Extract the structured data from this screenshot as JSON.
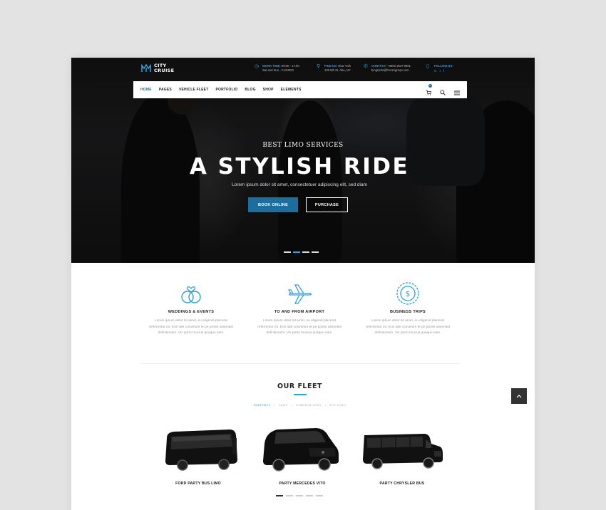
{
  "brand": {
    "line1": "CITY",
    "line2": "CRUISE"
  },
  "topbar": {
    "work_time": {
      "label": "WORK TIME:",
      "line1": "09:00 - 17:00",
      "line2": "Sat and Sun - CLOSED"
    },
    "find_us": {
      "label": "FIND US:",
      "line1": "New York",
      "line2": "128 5th St. Abu, NY"
    },
    "contact": {
      "label": "CONTACT:",
      "line1": "+0800 2537 9901",
      "line2": "bingrizdo@frenzogroup.com"
    },
    "follow": {
      "label": "FOLLOW US:",
      "icons": [
        "in",
        "t",
        "f"
      ]
    }
  },
  "nav": {
    "items": [
      "HOME",
      "PAGES",
      "VEHICLE FLEET",
      "PORTFOLIO",
      "BLOG",
      "SHOP",
      "ELEMENTS"
    ],
    "cart_count": "0"
  },
  "hero": {
    "subtitle": "BEST LIMO SERVICES",
    "title": "A STYLISH RIDE",
    "text": "Lorem ipsum dolor sit amet, consectetuer adipiscing elit, sed diam",
    "book_label": "BOOK ONLINE",
    "purchase_label": "PURCHASE"
  },
  "services": [
    {
      "icon": "rings-icon",
      "title": "WEDDINGS & EVENTS",
      "line1": "Lorem ipsum dolor sit amet, eu eligendi placerat",
      "line2": "referrentur no. Eos tale convenire te pe posse assential",
      "line3": "definitionem. Vix purto mucius quaque eam."
    },
    {
      "icon": "airplane-icon",
      "title": "TO AND FROM AIRPORT",
      "line1": "Lorem ipsum dolor sit amet, eu eligendi placerat",
      "line2": "referrentur no. Eos tale convenire te pe posse assential",
      "line3": "definitionem. Vix purto mucius quaque eam."
    },
    {
      "icon": "coin-icon",
      "title": "BUSINESS TRIPS",
      "line1": "Lorem ipsum dolor sit amet, eu eligendi placerat",
      "line2": "referrentur no. Eos tale convenire te pe posse assential",
      "line3": "definitionem. Vix purto mucius quaque eam."
    }
  ],
  "fleet": {
    "title": "OUR FLEET",
    "filters": [
      "PARTYBUS",
      "VANS",
      "STRETCH LIMO",
      "SUV LIMO"
    ],
    "separator": "/",
    "vehicles": [
      "FORD PARTY BUS LIMO",
      "PARTY MERCEDES VITO",
      "PARTY CHRYSLER BUS"
    ]
  },
  "colors": {
    "accent": "#2f9fd8",
    "button": "#1a6fa0",
    "dark": "#222222"
  },
  "scroll_top": {
    "icon": "chevron-up-icon"
  }
}
